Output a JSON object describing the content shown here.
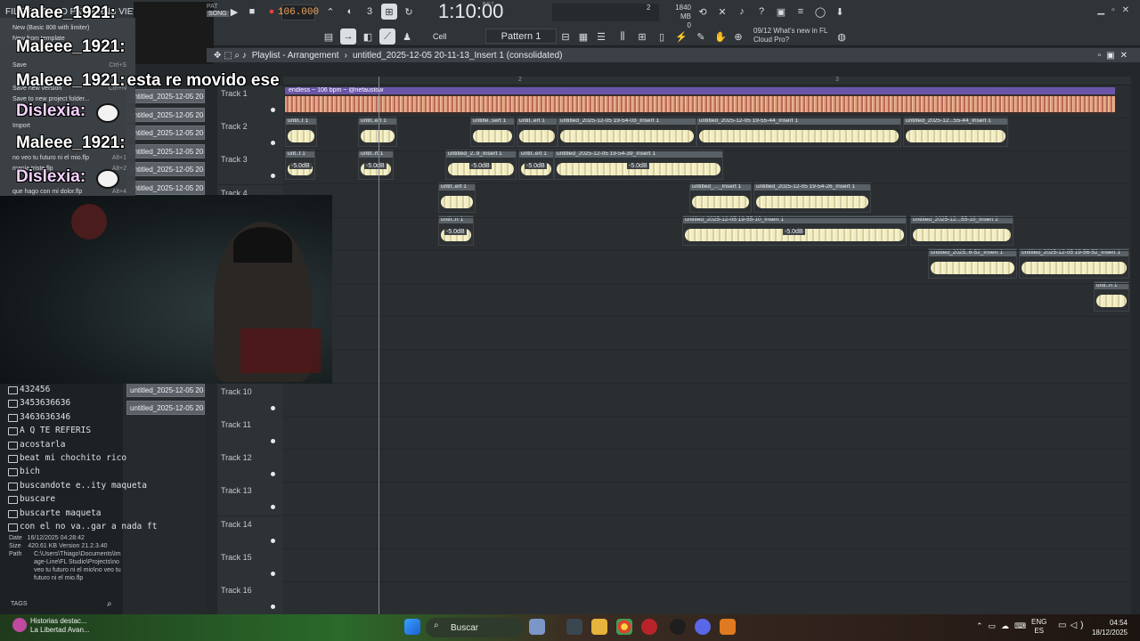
{
  "toolbar": {
    "menu_text": "FILE EDIT ADD PATTERNS VIEW OPTIONS TOOLS ?",
    "song_label": "SONG",
    "pat_label": "PAT",
    "tempo": "106.000",
    "time": "1:10:00",
    "time_sup": "B:S:T",
    "cpu": "2",
    "memory": "1840 MB",
    "memory_sub": "0",
    "pattern": "Pattern 1",
    "snap": "Cell",
    "news_date": "09/12",
    "news_text": "What's new in FL Cloud Pro?"
  },
  "playlist": {
    "title": "Playlist - Arrangement",
    "breadcrumb": "untitled_2025-12-05 20-11-13_Insert 1 (consolidated)",
    "ruler": [
      "2",
      "3"
    ]
  },
  "tracks": [
    {
      "label": "Track 1"
    },
    {
      "label": "Track 2"
    },
    {
      "label": "Track 3"
    },
    {
      "label": "Track 4"
    },
    {
      "label": "Track 5"
    },
    {
      "label": "Track 6"
    },
    {
      "label": "Track 7"
    },
    {
      "label": "Track 8"
    },
    {
      "label": "Track 9"
    },
    {
      "label": "Track 10"
    },
    {
      "label": "Track 11"
    },
    {
      "label": "Track 12"
    },
    {
      "label": "Track 13"
    },
    {
      "label": "Track 14"
    },
    {
      "label": "Track 15"
    },
    {
      "label": "Track 16"
    }
  ],
  "clips": {
    "endless": "endless ~ 106 bpm ~ @nefaustow",
    "t2": [
      "untit..t 1",
      "untit..ert 1",
      "untitle..sert 1",
      "untit..ert 1",
      "untitled_2025-12-05 19-54-03_Insert 1",
      "untitled_2025-12-05 19-55-44_Insert 1",
      "untitled_2025-12...55-44_Insert 1"
    ],
    "t3": [
      "unt..t 1",
      "untit..rt 1",
      "untitled_2..9_Insert 1",
      "untit..ert 1",
      "untitled_2025-12-05 19-54-39_Insert 1"
    ],
    "t3_gain": "-5.0dB",
    "t4": [
      "untit..ert 1",
      "untitled_..._Insert 1",
      "untitled_2025-12-05 19-54-26_Insert 1"
    ],
    "t5": [
      "untit..rt 1",
      "untitled_2025-12-05 19-55-10_Insert 1",
      "untitled_2025-12...55-10_Insert 1"
    ],
    "t6": [
      "untitled_2025..6-52_Insert 1",
      "untitled_2025-12-05 19-56-52_Insert 1"
    ],
    "t7": [
      "unti..rt 1"
    ]
  },
  "patterns": [
    "untitled_2025-12-05 20-",
    "untitled_2025-12-05 20-",
    "untitled_2025-12-05 20-",
    "untitled_2025-12-05 20-",
    "untitled_2025-12-05 20-",
    "untitled_2025-12-05 20-",
    "untitled_2025-12-05 20-",
    "untitled_2025-12-05 20-",
    "untitled_2025-12-05 20-",
    "untitled_2025-12-05 20-",
    "untitled_2025-12-05 20-",
    "untitled_2025-12-05 20-",
    "untitled_2025-12-05 20-",
    "untitled_2025-12-05 20-",
    "untitled_2025-12-05...",
    "untitled_2025-12-05 20-",
    "untitled_2025-12-05 20-",
    "untitled_2025-12-05 20-"
  ],
  "browser": {
    "items": [
      "432456",
      "3453636636",
      "3463636346",
      "A Q TE REFERIS",
      "acostarla",
      "beat mi chochito rico",
      "bich",
      "buscandote e..ity maqueta",
      "buscare",
      "buscarte maqueta",
      "con el no va..gar a nada ft"
    ],
    "info": {
      "date_label": "Date",
      "date": "16/12/2025 04:28:42",
      "size_label": "Size",
      "size": "420.61 KB",
      "version_label": "Version",
      "version": "21.2.3.40",
      "path_label": "Path",
      "path": "C:\\Users\\Thiago\\Documents\\Image-Line\\FL Studio\\Projects\\no veo tu futuro ni el mio\\no veo tu futuro ni el mio.flp"
    },
    "tags": "TAGS"
  },
  "filemenu": {
    "items": [
      {
        "label": "New (Basic 808 with limiter)",
        "shortcut": ""
      },
      {
        "label": "New from template",
        "shortcut": ""
      },
      {
        "label": "Save",
        "shortcut": "Ctrl+S"
      },
      {
        "label": "Save new version",
        "shortcut": "Ctrl+N"
      },
      {
        "label": "Save to new project folder...",
        "shortcut": ""
      },
      {
        "label": "Import",
        "shortcut": ""
      },
      {
        "label": "no veo tu futuro ni el mio.flp",
        "shortcut": "Alt+1"
      },
      {
        "label": "mania triste.flp",
        "shortcut": "Alt+2"
      },
      {
        "label": "que hago con mi dolor.flp",
        "shortcut": "Alt+4"
      }
    ]
  },
  "chat": [
    {
      "user": "Malee_1921:",
      "text": ""
    },
    {
      "user": "Maleee_1921:",
      "text": ""
    },
    {
      "user": "Maleee_1921:",
      "text": "esta re movido ese"
    },
    {
      "user": "Dislexia:",
      "text": ""
    },
    {
      "user": "Maleee_1921:",
      "text": ""
    },
    {
      "user": "Dislexia:",
      "text": ""
    }
  ],
  "taskbar": {
    "news_title": "Historias destac...",
    "news_sub": "La Libertad Avan...",
    "search": "Buscar",
    "lang": "ENG",
    "lang_sub": "ES",
    "time": "04:54",
    "date": "18/12/2025"
  },
  "colors": {
    "accent": "#f1a25a",
    "clip_header": "#5a6166",
    "waveform": "#f2ecc2",
    "endless_header": "#6a56a8"
  }
}
